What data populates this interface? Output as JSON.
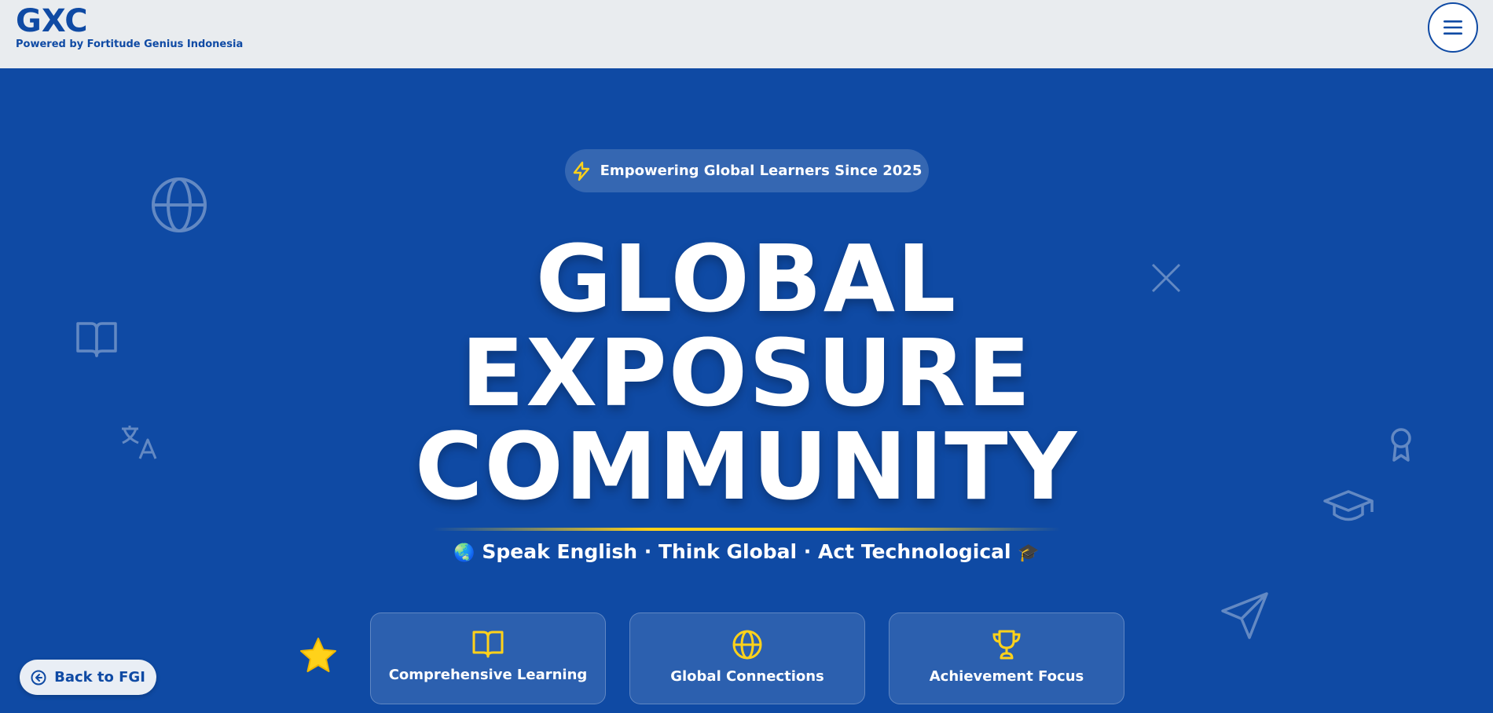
{
  "header": {
    "logo": "GXC",
    "tagline": "Powered by Fortitude Genius Indonesia",
    "menu_icon": "hamburger-menu-icon"
  },
  "hero": {
    "badge": {
      "icon": "lightning-icon",
      "text": "Empowering Global Learners Since 2025"
    },
    "title_lines": [
      "GLOBAL",
      "EXPOSURE",
      "COMMUNITY"
    ],
    "subtitle": {
      "emoji_left": "🌏",
      "text": "Speak English · Think Global · Act Technological",
      "emoji_right": "🎓"
    },
    "features": [
      {
        "icon": "book-open-icon",
        "label": "Comprehensive Learning"
      },
      {
        "icon": "globe-icon",
        "label": "Global Connections"
      },
      {
        "icon": "trophy-icon",
        "label": "Achievement Focus"
      }
    ],
    "decorations": [
      "globe-icon",
      "book-open-icon",
      "translate-icon",
      "close-icon",
      "award-icon",
      "graduation-cap-icon",
      "send-icon",
      "star-icon"
    ]
  },
  "back_button": {
    "icon": "arrow-left-circle-icon",
    "label": "Back to FGI"
  },
  "colors": {
    "brand_blue": "#0f4aa4",
    "accent_yellow": "#ffd21a",
    "header_bg": "#e9ecef"
  }
}
